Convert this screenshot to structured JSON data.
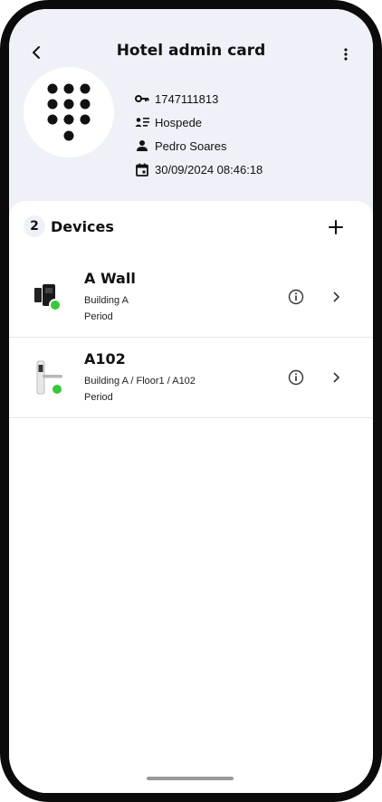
{
  "header": {
    "title": "Hotel admin card",
    "back_icon": "back-arrow-icon",
    "menu_icon": "more-vert-icon"
  },
  "card": {
    "avatar_icon": "keypad-icon",
    "id": "1747111813",
    "type": "Hospede",
    "owner": "Pedro Soares",
    "date": "30/09/2024 08:46:18"
  },
  "devices_section": {
    "count": "2",
    "title": "Devices",
    "add_icon": "plus-icon"
  },
  "devices": [
    {
      "name": "A Wall",
      "location": "Building A",
      "period": "Period",
      "status_color": "#35c93b"
    },
    {
      "name": "A102",
      "location": "Building A / Floor1 / A102",
      "period": "Period",
      "status_color": "#35c93b"
    }
  ],
  "colors": {
    "header_bg": "#eef1f7",
    "status_online": "#35c93b"
  }
}
